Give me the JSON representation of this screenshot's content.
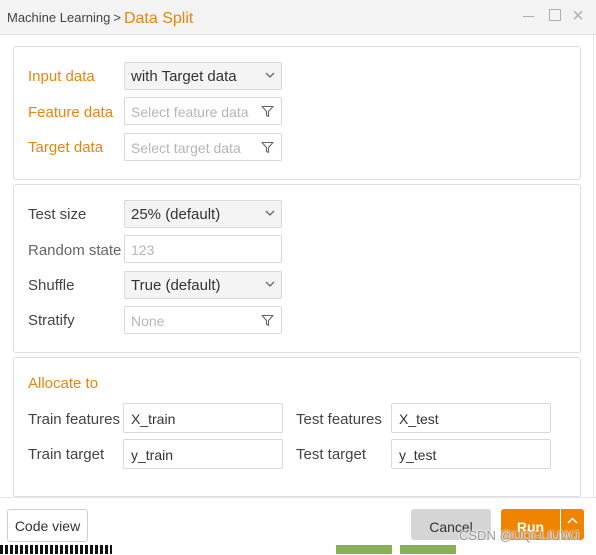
{
  "window": {
    "breadcrumb_parent": "Machine Learning",
    "breadcrumb_separator": ">",
    "title": "Data Split",
    "icons": {
      "minimize": "minimize-icon",
      "maximize": "maximize-icon",
      "close": "close-icon"
    }
  },
  "input_section": {
    "input_data_label": "Input data",
    "input_data_value": "with Target data",
    "feature_data_label": "Feature data",
    "feature_data_placeholder": "Select feature data",
    "target_data_label": "Target data",
    "target_data_placeholder": "Select target data"
  },
  "options_section": {
    "test_size_label": "Test size",
    "test_size_value": "25% (default)",
    "random_state_label": "Random state",
    "random_state_placeholder": "123",
    "shuffle_label": "Shuffle",
    "shuffle_value": "True (default)",
    "stratify_label": "Stratify",
    "stratify_placeholder": "None"
  },
  "allocate_section": {
    "title": "Allocate to",
    "train_features_label": "Train features",
    "train_features_value": "X_train",
    "test_features_label": "Test features",
    "test_features_value": "X_test",
    "train_target_label": "Train target",
    "train_target_value": "y_train",
    "test_target_label": "Test target",
    "test_target_value": "y_test"
  },
  "footer": {
    "code_view_label": "Code view",
    "cancel_label": "Cancel",
    "run_label": "Run"
  },
  "watermark": "CSDN @UQI-LIUWJ",
  "colors": {
    "accent": "#e8850c",
    "run_button": "#f08300"
  }
}
